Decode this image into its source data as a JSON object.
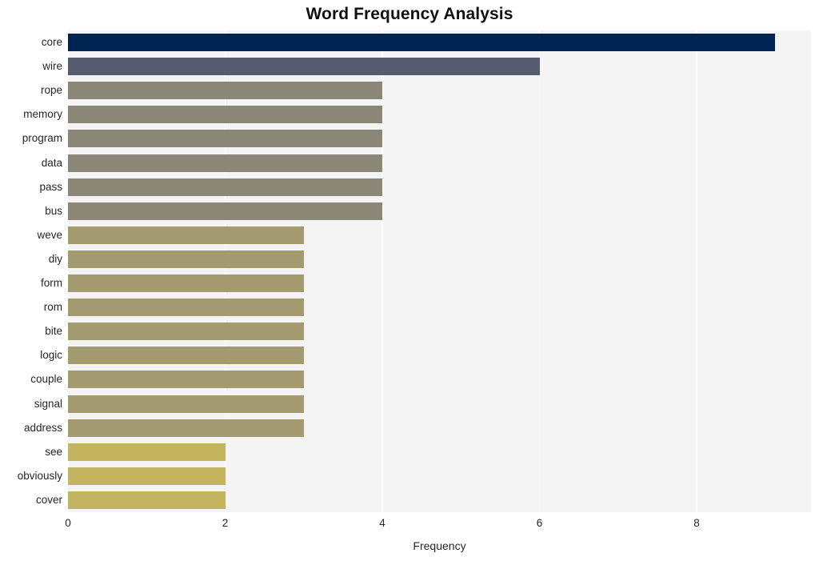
{
  "chart_data": {
    "type": "bar",
    "orientation": "horizontal",
    "title": "Word Frequency Analysis",
    "xlabel": "Frequency",
    "ylabel": "",
    "categories": [
      "core",
      "wire",
      "rope",
      "memory",
      "program",
      "data",
      "pass",
      "bus",
      "weve",
      "diy",
      "form",
      "rom",
      "bite",
      "logic",
      "couple",
      "signal",
      "address",
      "see",
      "obviously",
      "cover"
    ],
    "values": [
      9,
      6,
      4,
      4,
      4,
      4,
      4,
      4,
      3,
      3,
      3,
      3,
      3,
      3,
      3,
      3,
      3,
      2,
      2,
      2
    ],
    "bar_colors": [
      "#002451",
      "#565b70",
      "#8b8776",
      "#8b8776",
      "#8b8776",
      "#8b8776",
      "#8b8776",
      "#8b8776",
      "#a39a6f",
      "#a39a6f",
      "#a39a6f",
      "#a39a6f",
      "#a39a6f",
      "#a39a6f",
      "#a39a6f",
      "#a39a6f",
      "#a39a6f",
      "#c4b45f",
      "#c4b45f",
      "#c4b45f"
    ],
    "xlim": [
      0,
      9.455
    ],
    "xticks": [
      0,
      2,
      4,
      6,
      8
    ],
    "xtick_labels": [
      "0",
      "2",
      "4",
      "6",
      "8"
    ],
    "grid": "vertical",
    "legend": "none",
    "plot_background": "#f4f4f4",
    "gridline_color": "#ffffff",
    "figure_background": "#ffffff"
  }
}
